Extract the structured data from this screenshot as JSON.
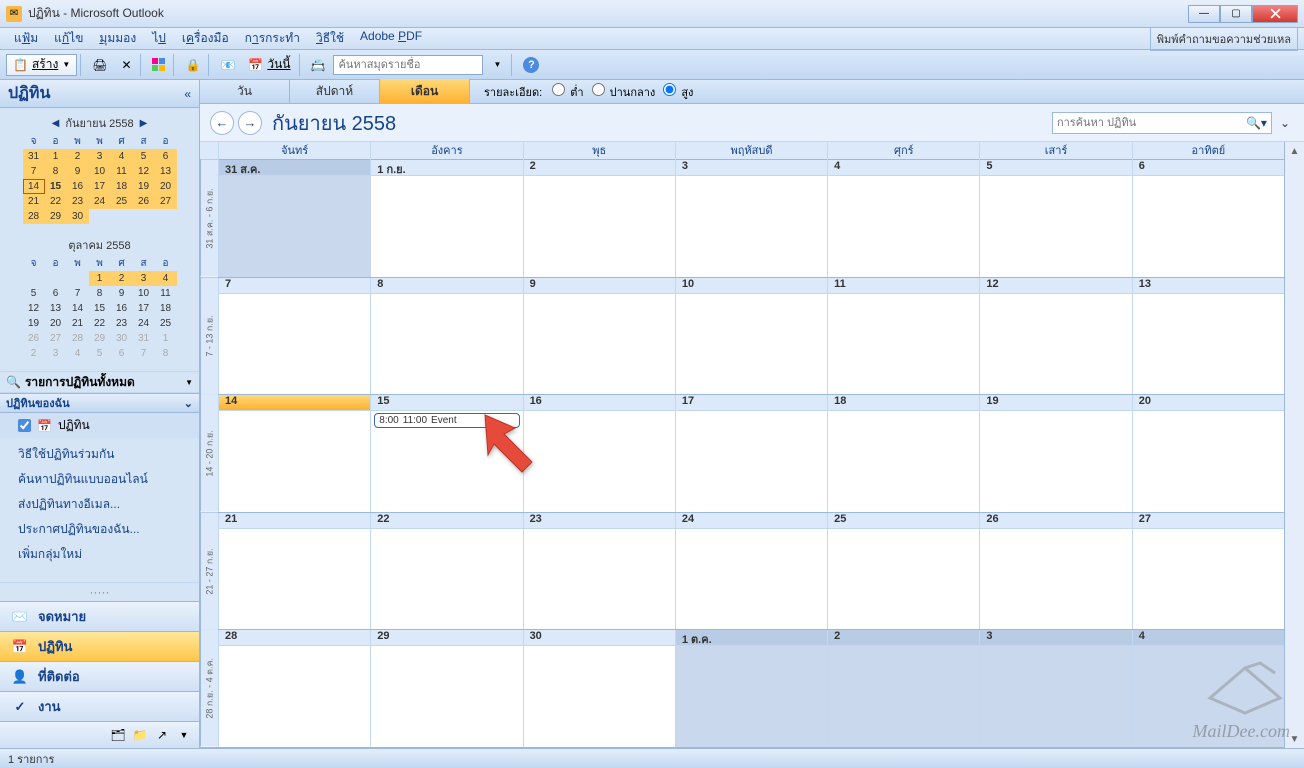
{
  "window": {
    "title": "ปฏิทิน - Microsoft Outlook"
  },
  "menu": {
    "items": [
      "แ<u>ฟ</u>้ม",
      "แ<u>ก้</u>ไข",
      "<u>มุ</u>มมอง",
      "ไ<u>ป</u>",
      "เ<u>ค</u>รื่องมือ",
      "ก<u>า</u>รกระทำ",
      "<u>วิ</u>ธีใช้",
      "Adobe <u>P</u>DF"
    ],
    "right": "พิมพ์คำถามขอความช่วยเหล"
  },
  "toolbar": {
    "new_label": "สร้าง",
    "today_label": "วันนี้",
    "search_placeholder": "ค้นหาสมุดรายชื่อ"
  },
  "nav": {
    "title": "ปฏิทิน",
    "cal1": {
      "title": "กันยายน 2558",
      "dow": [
        "จ",
        "อ",
        "พ",
        "พ",
        "ศ",
        "ส",
        "อ"
      ],
      "rows": [
        [
          "31",
          "1",
          "2",
          "3",
          "4",
          "5",
          "6"
        ],
        [
          "7",
          "8",
          "9",
          "10",
          "11",
          "12",
          "13"
        ],
        [
          "14",
          "15",
          "16",
          "17",
          "18",
          "19",
          "20"
        ],
        [
          "21",
          "22",
          "23",
          "24",
          "25",
          "26",
          "27"
        ],
        [
          "28",
          "29",
          "30",
          "",
          "",
          "",
          ""
        ]
      ]
    },
    "cal2": {
      "title": "ตุลาคม 2558",
      "dow": [
        "จ",
        "อ",
        "พ",
        "พ",
        "ศ",
        "ส",
        "อ"
      ],
      "rows": [
        [
          "",
          "",
          "",
          "1",
          "2",
          "3",
          "4"
        ],
        [
          "5",
          "6",
          "7",
          "8",
          "9",
          "10",
          "11"
        ],
        [
          "12",
          "13",
          "14",
          "15",
          "16",
          "17",
          "18"
        ],
        [
          "19",
          "20",
          "21",
          "22",
          "23",
          "24",
          "25"
        ],
        [
          "26",
          "27",
          "28",
          "29",
          "30",
          "31",
          "1"
        ],
        [
          "2",
          "3",
          "4",
          "5",
          "6",
          "7",
          "8"
        ]
      ]
    },
    "all_items": "รายการปฏิทินทั้งหมด",
    "my_cal_head": "ปฏิทินของฉัน",
    "my_cal_item": "ปฏิทิน",
    "links": [
      "วิธีใช้ปฏิทินร่วมกัน",
      "ค้นหาปฏิทินแบบออนไลน์",
      "ส่งปฏิทินทางอีเมล...",
      "ประกาศปฏิทินของฉัน...",
      "เพิ่มกลุ่มใหม่"
    ],
    "btns": {
      "mail": "จดหมาย",
      "calendar": "ปฏิทิน",
      "contacts": "ที่ติดต่อ",
      "tasks": "งาน"
    }
  },
  "view": {
    "tabs": [
      "วัน",
      "สัปดาห์",
      "เดือน"
    ],
    "active": 2,
    "detail_label": "รายละเอียด:",
    "detail_opts": [
      "ต่ำ",
      "ปานกลาง",
      "สูง"
    ],
    "detail_sel": 2
  },
  "calendar": {
    "month_title": "กันยายน 2558",
    "search_placeholder": "การค้นหา ปฏิทิน",
    "dow": [
      "จันทร์",
      "อังคาร",
      "พุธ",
      "พฤหัสบดี",
      "ศุกร์",
      "เสาร์",
      "อาทิตย์"
    ],
    "weeks": [
      {
        "label": "31 ส.ค. - 6 ก.ย.",
        "days": [
          {
            "d": "31 ส.ค.",
            "other": true
          },
          {
            "d": "1 ก.ย."
          },
          {
            "d": "2"
          },
          {
            "d": "3"
          },
          {
            "d": "4"
          },
          {
            "d": "5"
          },
          {
            "d": "6"
          }
        ]
      },
      {
        "label": "7 - 13 ก.ย.",
        "days": [
          {
            "d": "7"
          },
          {
            "d": "8"
          },
          {
            "d": "9"
          },
          {
            "d": "10"
          },
          {
            "d": "11"
          },
          {
            "d": "12"
          },
          {
            "d": "13"
          }
        ]
      },
      {
        "label": "14 - 20 ก.ย.",
        "days": [
          {
            "d": "14",
            "today": true
          },
          {
            "d": "15",
            "events": [
              {
                "start": "8:00",
                "end": "11:00",
                "title": "Event"
              }
            ]
          },
          {
            "d": "16"
          },
          {
            "d": "17"
          },
          {
            "d": "18"
          },
          {
            "d": "19"
          },
          {
            "d": "20"
          }
        ]
      },
      {
        "label": "21 - 27 ก.ย.",
        "days": [
          {
            "d": "21"
          },
          {
            "d": "22"
          },
          {
            "d": "23"
          },
          {
            "d": "24"
          },
          {
            "d": "25"
          },
          {
            "d": "26"
          },
          {
            "d": "27"
          }
        ]
      },
      {
        "label": "28 ก.ย. - 4 ต.ค.",
        "days": [
          {
            "d": "28"
          },
          {
            "d": "29"
          },
          {
            "d": "30"
          },
          {
            "d": "1 ต.ค.",
            "other": true
          },
          {
            "d": "2",
            "other": true
          },
          {
            "d": "3",
            "other": true
          },
          {
            "d": "4",
            "other": true
          }
        ]
      }
    ]
  },
  "status": {
    "text": "1 รายการ"
  },
  "watermark": {
    "text": "MailDee.com"
  }
}
